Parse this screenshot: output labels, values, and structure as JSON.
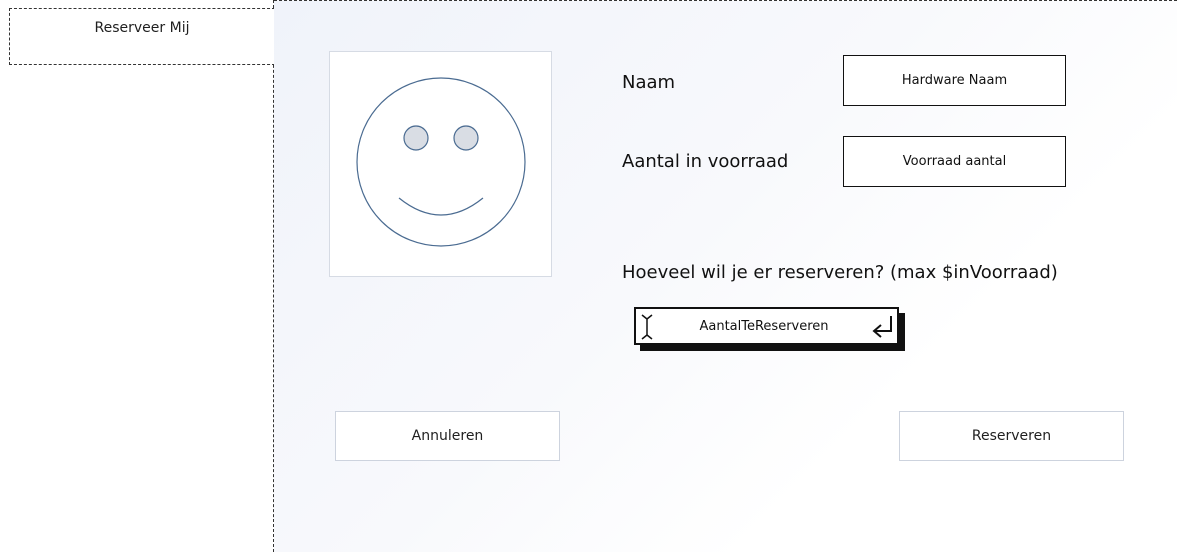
{
  "sidebar": {
    "tab_label": "Reserveer Mij"
  },
  "form": {
    "name_label": "Naam",
    "name_value": "Hardware Naam",
    "stock_label": "Aantal in voorraad",
    "stock_value": "Voorraad aantal",
    "question": "Hoeveel wil je er reserveren? (max $inVoorraad)",
    "amount_value": "AantalTeReserveren"
  },
  "buttons": {
    "cancel_label": "Annuleren",
    "reserve_label": "Reserveren"
  },
  "icons": {
    "image_placeholder": "smiley-icon",
    "cursor": "text-cursor-icon",
    "enter": "enter-arrow-icon"
  },
  "colors": {
    "smiley_stroke": "#4a6b91",
    "eye_fill": "#d9dde4"
  }
}
